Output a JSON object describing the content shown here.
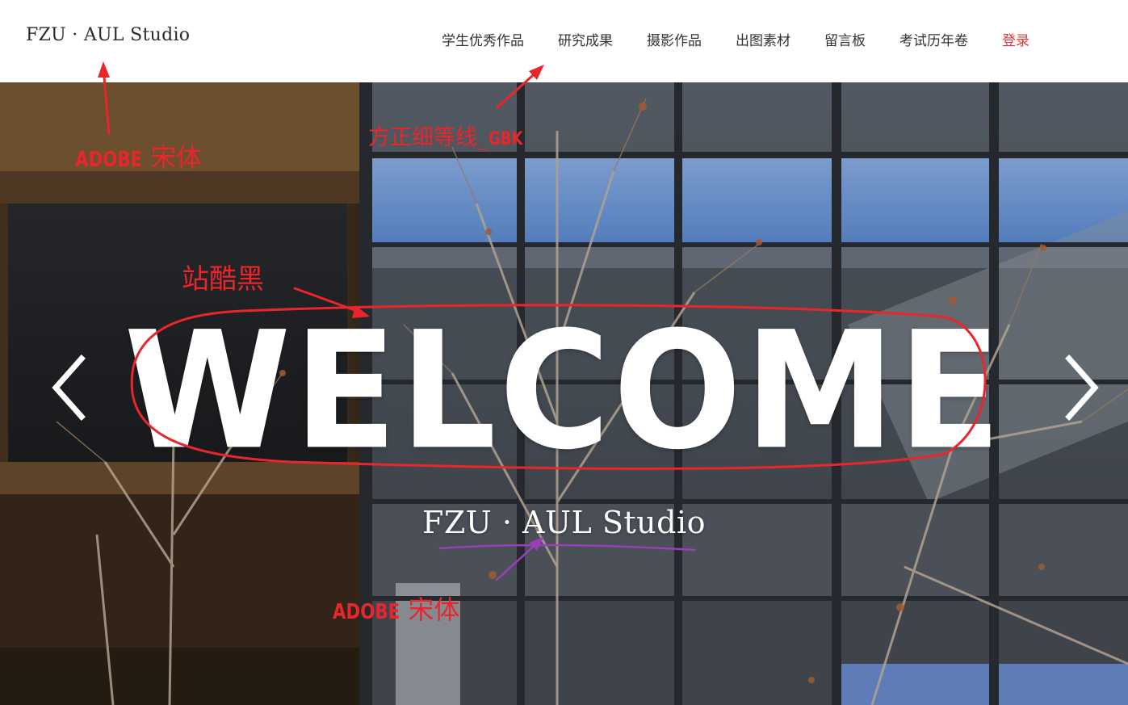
{
  "header": {
    "logo": "FZU · AUL Studio",
    "nav": [
      {
        "label": "学生优秀作品"
      },
      {
        "label": "研究成果"
      },
      {
        "label": "摄影作品"
      },
      {
        "label": "出图素材"
      },
      {
        "label": "留言板"
      },
      {
        "label": "考试历年卷"
      },
      {
        "label": "登录"
      }
    ]
  },
  "hero": {
    "title": "WELCOME",
    "subtitle": "FZU · AUL Studio",
    "prev_icon": "chevron-left-icon",
    "next_icon": "chevron-right-icon"
  },
  "annotations": {
    "logo_font": {
      "en": "ADOBE",
      "zh": "宋体"
    },
    "nav_font": {
      "zh": "方正细等线_",
      "en": "GBK"
    },
    "title_font": "站酷黑",
    "subtitle_font": {
      "en": "ADOBE",
      "zh": "宋体"
    }
  },
  "colors": {
    "annotation": "#e8262b",
    "underline": "#9b3fb8",
    "login": "#d23a3a",
    "text": "#333333"
  }
}
